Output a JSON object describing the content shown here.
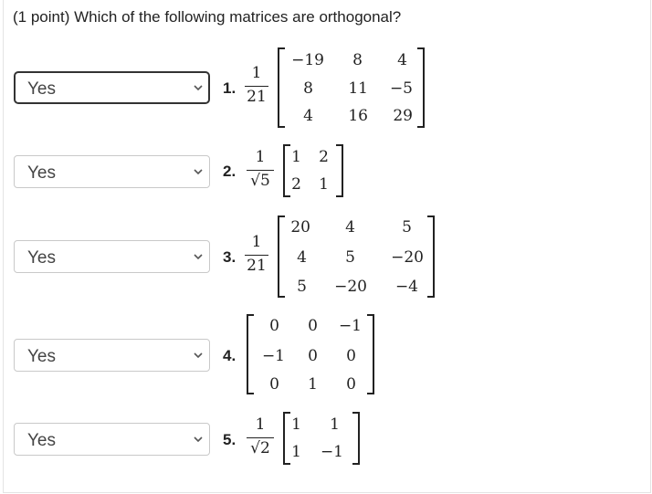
{
  "question": {
    "points": "(1 point)",
    "text": "Which of the following matrices are orthogonal?"
  },
  "items": [
    {
      "index": "1.",
      "answer": "Yes",
      "scalar_num": "1",
      "scalar_den": "21",
      "matrix": [
        [
          "−19",
          "8",
          "4"
        ],
        [
          "8",
          "11",
          "−5"
        ],
        [
          "4",
          "16",
          "29"
        ]
      ]
    },
    {
      "index": "2.",
      "answer": "Yes",
      "scalar_num": "1",
      "scalar_den": "√5",
      "matrix": [
        [
          "1",
          "2"
        ],
        [
          "2",
          "1"
        ]
      ]
    },
    {
      "index": "3.",
      "answer": "Yes",
      "scalar_num": "1",
      "scalar_den": "21",
      "matrix": [
        [
          "20",
          "4",
          "5"
        ],
        [
          "4",
          "5",
          "−20"
        ],
        [
          "5",
          "−20",
          "−4"
        ]
      ]
    },
    {
      "index": "4.",
      "answer": "Yes",
      "matrix": [
        [
          "0",
          "0",
          "−1"
        ],
        [
          "−1",
          "0",
          "0"
        ],
        [
          "0",
          "1",
          "0"
        ]
      ]
    },
    {
      "index": "5.",
      "answer": "Yes",
      "scalar_num": "1",
      "scalar_den": "√2",
      "matrix": [
        [
          "1",
          "1"
        ],
        [
          "1",
          "−1"
        ]
      ]
    }
  ],
  "icons": {
    "dropdown": "chevron-down-icon"
  }
}
